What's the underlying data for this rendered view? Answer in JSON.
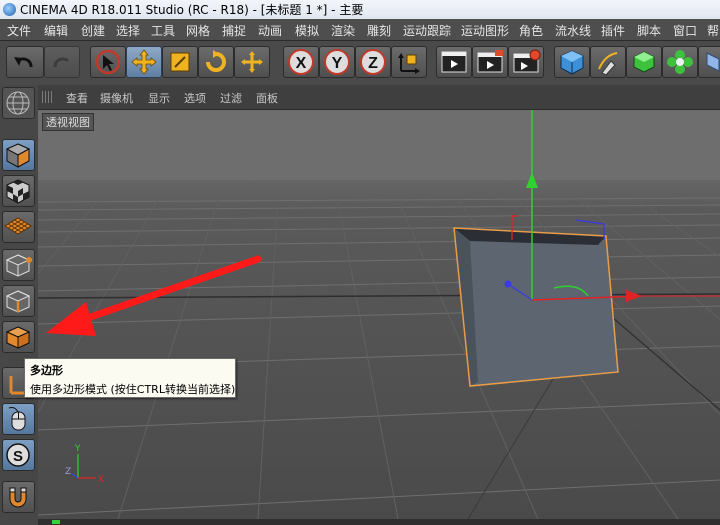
{
  "window": {
    "title": "CINEMA 4D R18.011 Studio (RC - R18) - [未标题 1 *] - 主要"
  },
  "menubar": {
    "items": [
      "文件",
      "编辑",
      "创建",
      "选择",
      "工具",
      "网格",
      "捕捉",
      "动画",
      "模拟",
      "渲染",
      "雕刻",
      "运动跟踪",
      "运动图形",
      "角色",
      "流水线",
      "插件",
      "脚本",
      "窗口",
      "帮"
    ]
  },
  "toolbar": {
    "axis_labels": {
      "x": "X",
      "y": "Y",
      "z": "Z"
    }
  },
  "viewport": {
    "menu": [
      "查看",
      "摄像机",
      "显示",
      "选项",
      "过滤",
      "面板"
    ],
    "label": "透视视图",
    "axis_labels": {
      "y": "Y",
      "z": "Z",
      "x": "X"
    }
  },
  "tooltip": {
    "title": "多边形",
    "description": "使用多边形模式 (按住CTRL转换当前选择)"
  },
  "colors": {
    "arrow_red": "#ff1a1a",
    "selection_orange": "#e89c4a",
    "axis_green": "#2fd12f",
    "axis_red": "#e02424",
    "axis_blue": "#3a3ae6",
    "active_blue": "#6f90b6"
  },
  "icons": [
    "undo-icon",
    "redo-icon",
    "select-arrow-icon",
    "move-icon",
    "scale-icon",
    "rotate-icon",
    "move-last-icon",
    "x-axis-icon",
    "y-axis-icon",
    "z-axis-icon",
    "world-coords-icon",
    "render-view-icon",
    "render-picture-icon",
    "render-settings-icon",
    "cube-icon",
    "pen-icon",
    "subdivision-icon",
    "cloner-icon",
    "sphere-icon"
  ]
}
